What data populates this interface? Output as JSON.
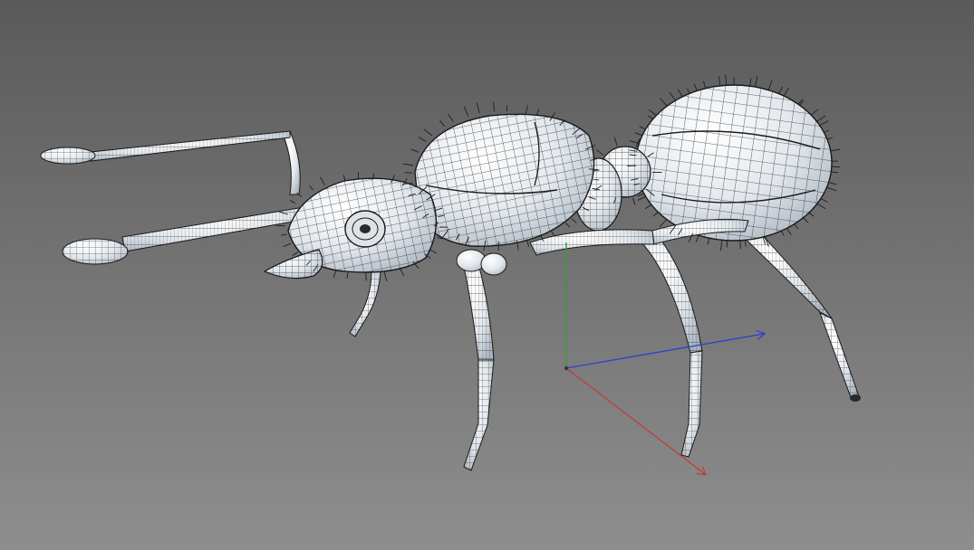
{
  "viewport": {
    "background_top": "#5a5a5a",
    "background_bottom": "#8e8e8e",
    "model_fill": "#e6eaee",
    "model_shade": "#b9c2cc",
    "wire_color": "#1a1a1a",
    "hair_color": "#1e1e1e",
    "model_name_icon": "ant-wireframe-model"
  },
  "axis_gizmo": {
    "x_axis_color": "#c43c3c",
    "y_axis_color": "#2fa02f",
    "z_axis_color": "#2d3fcf"
  }
}
